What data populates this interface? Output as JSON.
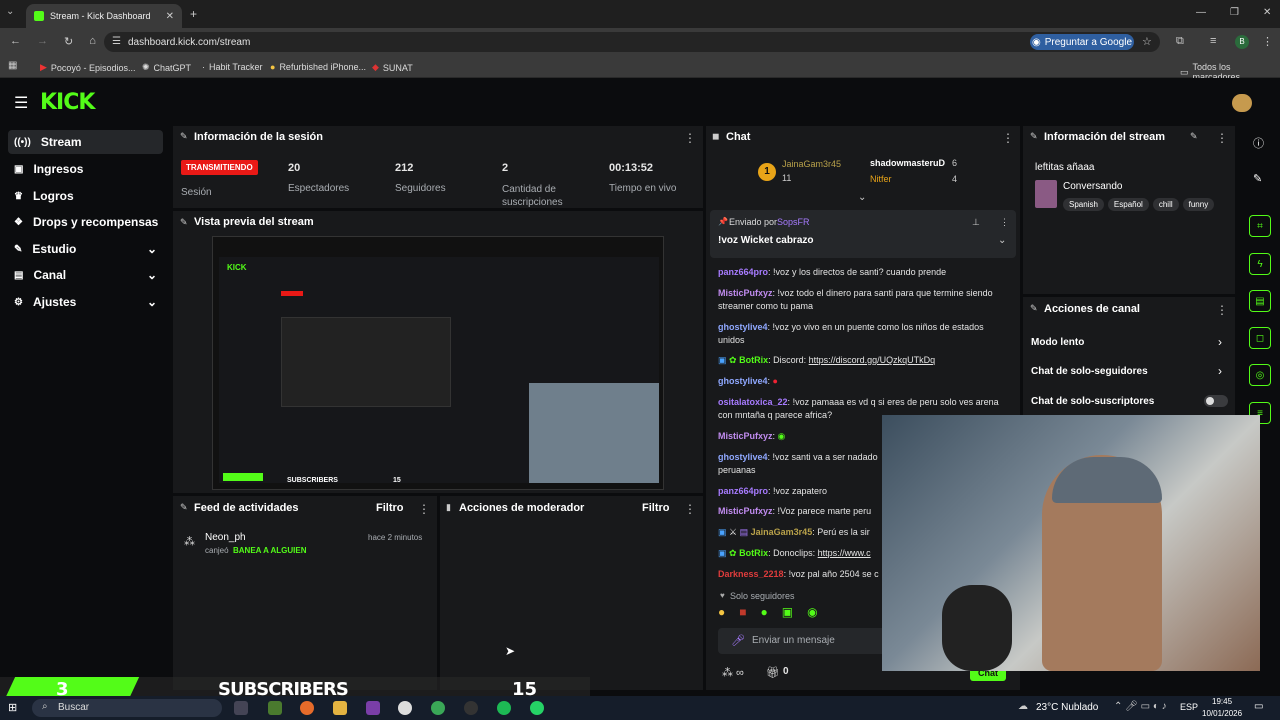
{
  "browser": {
    "tab_title": "Stream - Kick Dashboard",
    "url": "dashboard.kick.com/stream",
    "ask_google": "Preguntar a Google",
    "profile_initial": "B",
    "bookmarks": [
      "Pocoyó - Episodios...",
      "ChatGPT",
      "Habit Tracker",
      "Refurbished iPhone...",
      "SUNAT"
    ],
    "all_bookmarks": "Todos los marcadores"
  },
  "sidebar": {
    "items": [
      {
        "label": "Stream"
      },
      {
        "label": "Ingresos"
      },
      {
        "label": "Logros"
      },
      {
        "label": "Drops y recompensas"
      },
      {
        "label": "Estudio"
      },
      {
        "label": "Canal"
      },
      {
        "label": "Ajustes"
      }
    ]
  },
  "session": {
    "title": "Información de la sesión",
    "status": "TRANSMITIENDO",
    "status_label": "Sesión",
    "viewers": "20",
    "viewers_label": "Espectadores",
    "followers": "212",
    "followers_label": "Seguidores",
    "subs": "2",
    "subs_label": "Cantidad de suscripciones",
    "uptime": "00:13:52",
    "uptime_label": "Tiempo en vivo"
  },
  "preview": {
    "title": "Vista previa del stream"
  },
  "activity": {
    "title": "Feed de actividades",
    "filter": "Filtro",
    "user": "Neon_ph",
    "time": "hace 2 minutos",
    "action_prefix": "canjeó",
    "action": "BANEA A ALGUIEN"
  },
  "modactions": {
    "title": "Acciones de moderador",
    "filter": "Filtro"
  },
  "chat": {
    "title": "Chat",
    "leader1": "JainaGam3r45",
    "leader1_count": "11",
    "leader2": "shadowmasteruD",
    "leader2_count": "6",
    "leader3": "Nitfer",
    "leader3_count": "4",
    "pinned_by": "Enviado por",
    "pinned_user": "SopsFR",
    "pinned_msg": "!voz Wicket cabrazo",
    "messages": [
      {
        "user": "panz664pro",
        "text": "!voz y los directos de santi? cuando prende"
      },
      {
        "user": "MisticPufxyz",
        "text": "!voz todo el dinero para santi para que termine siendo streamer como tu pama"
      },
      {
        "user": "ghostylive4",
        "text": "!voz yo vivo en un puente como los niños de estados unidos"
      },
      {
        "user": "BotRix",
        "text": "Discord:",
        "link": "https://discord.gg/UQzkqUTkDq"
      },
      {
        "user": "ghostylive4",
        "text": ""
      },
      {
        "user": "ositalatoxica_22",
        "text": "!voz pamaaa es vd q si eres de peru solo ves arena con mntaña q parece africa?"
      },
      {
        "user": "MisticPufxyz",
        "text": ""
      },
      {
        "user": "ghostylive4",
        "text": "!voz santi va a ser nadado peruanas"
      },
      {
        "user": "panz664pro",
        "text": "!voz zapatero"
      },
      {
        "user": "MisticPufxyz",
        "text": "!Voz parece marte peru"
      },
      {
        "user": "JainaGam3r45",
        "text": "Perú es la sir"
      },
      {
        "user": "BotRix",
        "text": "Donoclips:",
        "link": "https://www.c"
      },
      {
        "user": "Darkness_2218",
        "text": "!voz pal año 2504 se c"
      }
    ],
    "followers_only": "Solo seguidores",
    "input_placeholder": "Enviar un mensaje",
    "points": "0",
    "send": "Chat"
  },
  "streaminfo": {
    "title": "Información del stream",
    "stream_title": "leftitas añaaa",
    "category": "Conversando",
    "tags": [
      "Spanish",
      "Español",
      "chill",
      "funny"
    ]
  },
  "channelactions": {
    "title": "Acciones de canal",
    "slow": "Modo lento",
    "followers_chat": "Chat de solo-seguidores",
    "subs_chat": "Chat de solo-suscriptores"
  },
  "overlay": {
    "subs": "3",
    "label": "SUBSCRIBERS",
    "goal": "15"
  },
  "taskbar": {
    "search": "Buscar",
    "weather": "23°C  Nublado",
    "lang": "ESP",
    "time": "19:45",
    "date": "10/01/2026"
  },
  "colors": {
    "accent": "#53fc18",
    "live": "#e91916"
  }
}
